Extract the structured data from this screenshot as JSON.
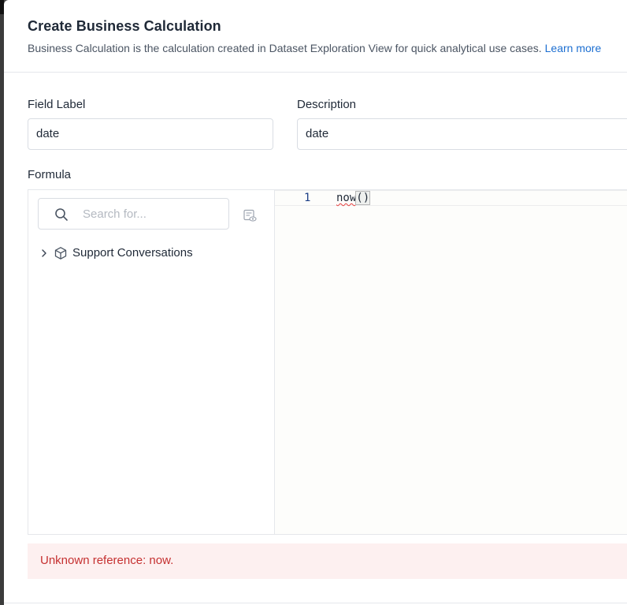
{
  "modal": {
    "title": "Create Business Calculation",
    "subtitle": "Business Calculation is the calculation created in Dataset Exploration View for quick analytical use cases.",
    "learn_more": "Learn more"
  },
  "form": {
    "field_label": {
      "label": "Field Label",
      "value": "date"
    },
    "description": {
      "label": "Description",
      "value": "date"
    },
    "formula_label": "Formula"
  },
  "explorer": {
    "search_placeholder": "Search for...",
    "tree": [
      {
        "label": "Support Conversations",
        "icon": "cube-icon",
        "expanded": false
      }
    ]
  },
  "editor": {
    "line_number": "1",
    "code_fn": "now",
    "code_parens": "()"
  },
  "error": {
    "message": "Unknown reference: now."
  },
  "colors": {
    "accent": "#1d6fd1",
    "error_text": "#c53030",
    "error_bg": "#fdf0f0"
  }
}
